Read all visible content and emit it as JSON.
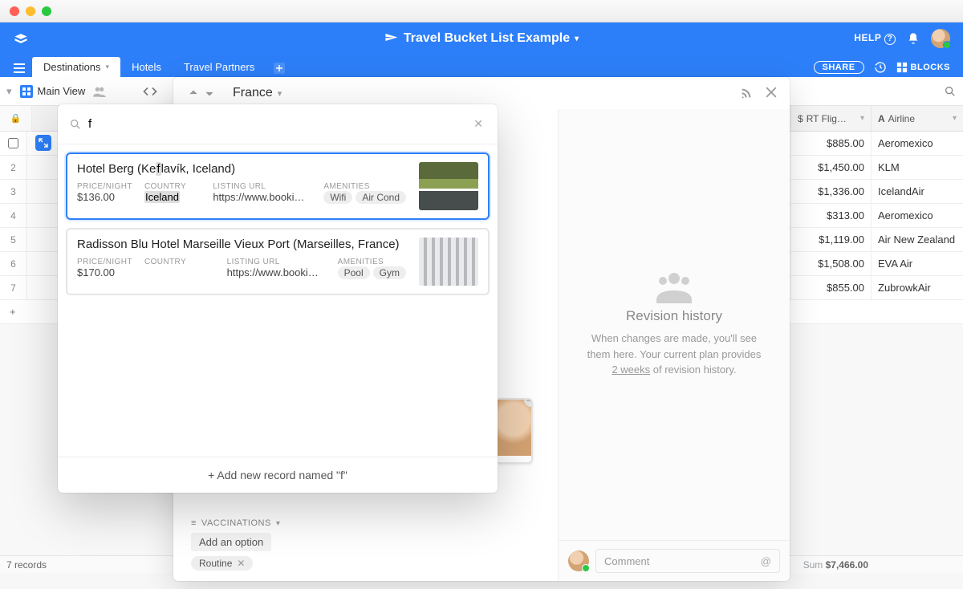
{
  "app": {
    "base_title": "Travel Bucket List Example",
    "help_label": "HELP"
  },
  "tabs": [
    {
      "label": "Destinations",
      "active": true
    },
    {
      "label": "Hotels",
      "active": false
    },
    {
      "label": "Travel Partners",
      "active": false
    }
  ],
  "toolbar": {
    "share_label": "SHARE",
    "blocks_label": "BLOCKS"
  },
  "view": {
    "name": "Main View"
  },
  "columns": {
    "rt_flight": "RT Flig…",
    "airline": "Airline"
  },
  "rows": [
    {
      "n": "",
      "rt": "$885.00",
      "airline": "Aeromexico"
    },
    {
      "n": "2",
      "rt": "$1,450.00",
      "airline": "KLM"
    },
    {
      "n": "3",
      "rt": "$1,336.00",
      "airline": "IcelandAir"
    },
    {
      "n": "4",
      "rt": "$313.00",
      "airline": "Aeromexico"
    },
    {
      "n": "5",
      "rt": "$1,119.00",
      "airline": "Air New Zealand"
    },
    {
      "n": "6",
      "rt": "$1,508.00",
      "airline": "EVA Air"
    },
    {
      "n": "7",
      "rt": "$855.00",
      "airline": "ZubrowkAir"
    }
  ],
  "grid_footer": {
    "count_label": "7 records",
    "sum_label": "Sum",
    "sum_value": "$7,466.00"
  },
  "record": {
    "title": "France"
  },
  "revision": {
    "title": "Revision history",
    "body_pre": "When changes are made, you'll see them here. Your current plan provides ",
    "body_link": "2 weeks",
    "body_post": " of revision history."
  },
  "comment": {
    "placeholder": "Comment"
  },
  "vaccinations": {
    "label": "VACCINATIONS",
    "add_label": "Add an option",
    "chip": "Routine"
  },
  "picker": {
    "query": "f",
    "items": [
      {
        "name_pre": "Hotel Berg (Ke",
        "name_mark": "f",
        "name_post": "lavík, Iceland)",
        "price_label": "PRICE/NIGHT",
        "price": "$136.00",
        "country_label": "COUNTRY",
        "country": "Iceland",
        "country_mark": true,
        "url_label": "LISTING URL",
        "url": "https://www.bookin…",
        "amen_label": "AMENITIES",
        "amenities": [
          "Wifi",
          "Air Cond"
        ],
        "thumb": "berg",
        "selected": true
      },
      {
        "name_full": "Radisson Blu Hotel Marseille Vieux Port (Marseilles, France)",
        "price_label": "PRICE/NIGHT",
        "price": "$170.00",
        "country_label": "COUNTRY",
        "country": "",
        "url_label": "LISTING URL",
        "url": "https://www.bookin…",
        "amen_label": "AMENITIES",
        "amenities": [
          "Pool",
          "Gym"
        ],
        "thumb": "rad",
        "selected": false
      }
    ],
    "footer": "+ Add new record named \"f\""
  }
}
